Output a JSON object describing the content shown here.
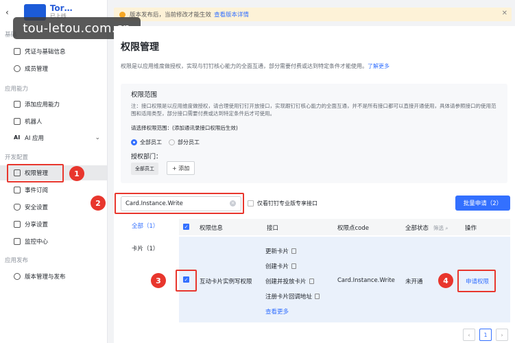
{
  "watermark": "tou-letou.com.cn",
  "app": {
    "name": "Tor…",
    "sub": "已上线"
  },
  "sidebar": {
    "sections": {
      "basic": "基础",
      "capability": "应用能力",
      "dev": "开发配置",
      "release": "应用发布"
    },
    "items": [
      {
        "label": "凭证与基础信息"
      },
      {
        "label": "成员管理"
      },
      {
        "label": "添加应用能力"
      },
      {
        "label": "机器人"
      },
      {
        "label": "AI 应用"
      },
      {
        "label": "权限管理"
      },
      {
        "label": "事件订阅"
      },
      {
        "label": "安全设置"
      },
      {
        "label": "分享设置"
      },
      {
        "label": "监控中心"
      },
      {
        "label": "版本管理与发布"
      }
    ]
  },
  "notice": {
    "text": "版本发布后，当前修改才能生效",
    "link": "查看版本详情"
  },
  "page": {
    "title": "权限管理",
    "desc": "权限是以应用维度做授权，实现与钉钉核心能力的全面互通，部分需要付费或达到特定条件才能使用。",
    "desc_link": "了解更多"
  },
  "scope": {
    "title": "权限范围",
    "note": "注：接口权限是以应用维度做授权，请合理使用钉钉开放接口，实现跟钉钉核心能力的全面互通，并不是所有接口都可以直接开通使用，具体请参照接口的使用范围和适用类型，部分接口需要付费或达到特定条件后才可使用。",
    "select_label": "请选择权限范围：(添加通讯录接口权限后生效)",
    "radio_all": "全部员工",
    "radio_part": "部分员工",
    "dept_label": "授权部门：",
    "dept_tag": "全部员工",
    "add_label": "+ 添加"
  },
  "search": {
    "value": "Card.Instance.Write"
  },
  "only_pro": "仅看钉钉专业版专享接口",
  "batch": "批量申请（2）",
  "categories": [
    {
      "label": "全部（1）"
    },
    {
      "label": "卡片（1）"
    }
  ],
  "table": {
    "headers": {
      "info": "权限信息",
      "api": "接口",
      "code": "权限点code",
      "status": "全部状态",
      "filter": "筛选",
      "op": "操作"
    },
    "row": {
      "info": "互动卡片实例写权限",
      "apis": [
        "更新卡片",
        "创建卡片",
        "创建并投放卡片",
        "注册卡片回调地址"
      ],
      "more": "查看更多",
      "code": "Card.Instance.Write",
      "status": "未开通",
      "action": "申请权限"
    }
  },
  "pager": {
    "current": "1"
  },
  "badges": [
    "1",
    "2",
    "3",
    "4"
  ],
  "colors": {
    "accent": "#3370ff",
    "annotation": "#e8362d",
    "row_bg": "#eaf1fb"
  }
}
